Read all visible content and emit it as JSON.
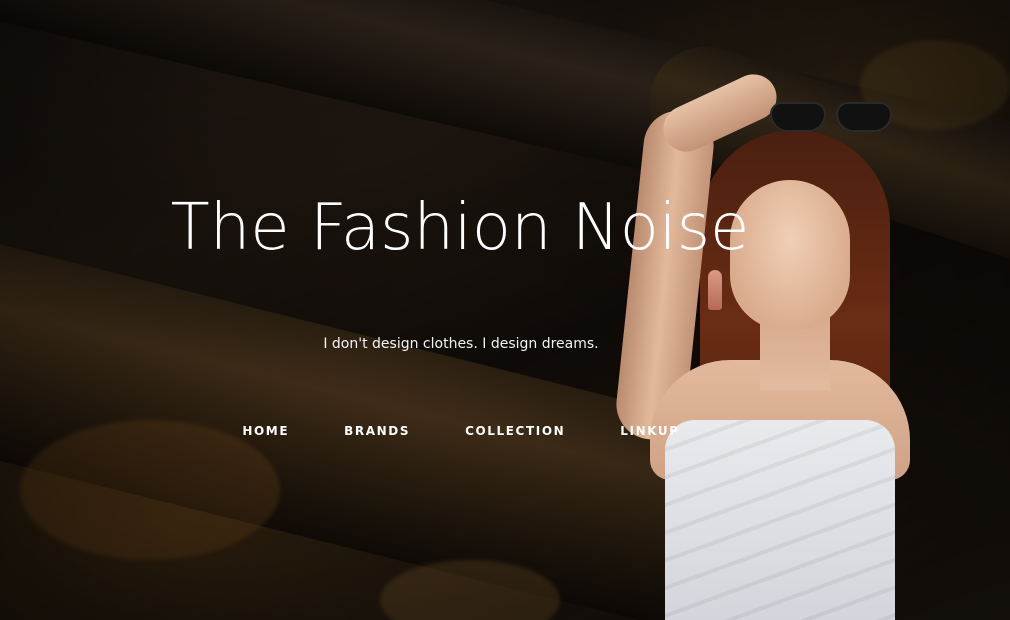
{
  "hero": {
    "title": "The Fashion Noise",
    "tagline": "I don't design clothes. I design dreams."
  },
  "nav": {
    "items": [
      {
        "label": "HOME"
      },
      {
        "label": "BRANDS"
      },
      {
        "label": "COLLECTION"
      },
      {
        "label": "LINKUP"
      }
    ]
  },
  "colors": {
    "text": "#ffffff",
    "background": "#1a1410"
  }
}
